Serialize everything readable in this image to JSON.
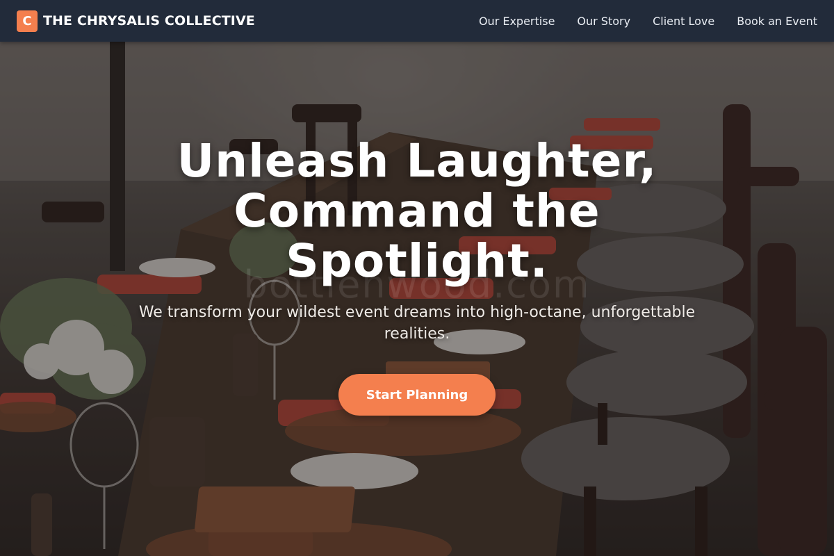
{
  "brand": {
    "logo_letter": "C",
    "name": "THE CHRYSALIS COLLECTIVE",
    "accent_color": "#f47f4e"
  },
  "nav": {
    "background_color": "#222b3a",
    "items": [
      {
        "label": "Our Expertise"
      },
      {
        "label": "Our Story"
      },
      {
        "label": "Client Love"
      },
      {
        "label": "Book an Event"
      }
    ]
  },
  "hero": {
    "background_image": "outdoor dinner table with wooden chairs, napkins and wine glasses",
    "title": "Unleash Laughter, Command the Spotlight.",
    "subtitle": "We transform your wildest event dreams into high-octane, unforgettable realities.",
    "cta_label": "Start Planning",
    "watermark": "bottlenwood.com"
  }
}
